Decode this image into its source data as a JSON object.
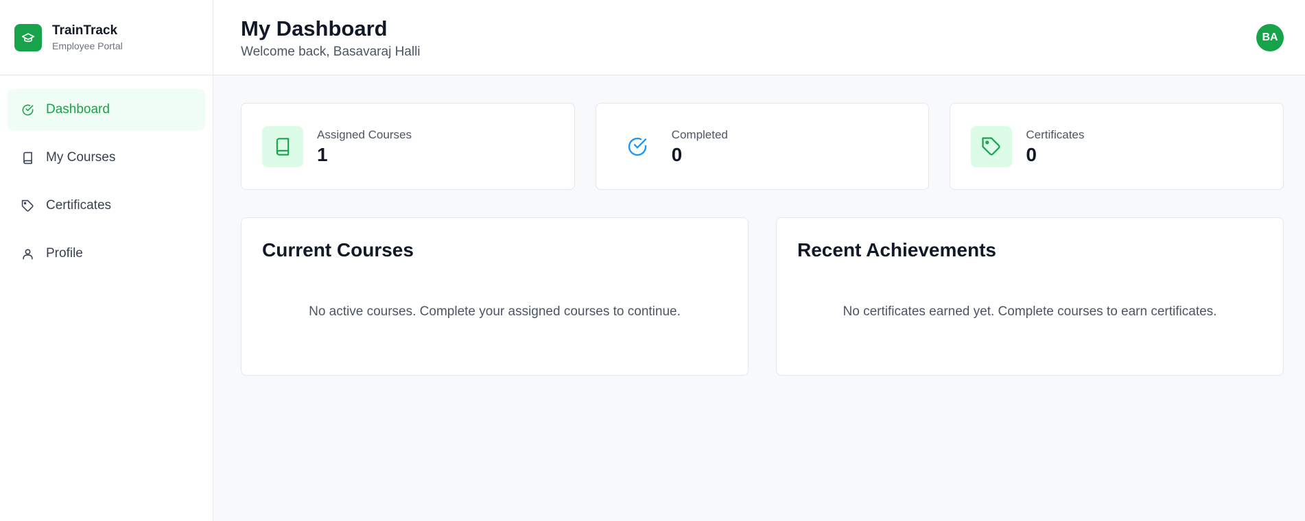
{
  "brand": {
    "name": "TrainTrack",
    "subtitle": "Employee Portal"
  },
  "sidebar": {
    "items": [
      {
        "label": "Dashboard",
        "icon": "check-circle-icon",
        "active": true
      },
      {
        "label": "My Courses",
        "icon": "book-icon",
        "active": false
      },
      {
        "label": "Certificates",
        "icon": "tag-icon",
        "active": false
      },
      {
        "label": "Profile",
        "icon": "user-icon",
        "active": false
      }
    ]
  },
  "header": {
    "title": "My Dashboard",
    "welcome": "Welcome back, Basavaraj Halli",
    "avatar_initials": "BA"
  },
  "stats": [
    {
      "label": "Assigned Courses",
      "value": "1",
      "icon": "book-icon"
    },
    {
      "label": "Completed",
      "value": "0",
      "icon": "check-circle-icon"
    },
    {
      "label": "Certificates",
      "value": "0",
      "icon": "tag-icon"
    }
  ],
  "panels": {
    "current_courses": {
      "title": "Current Courses",
      "empty_text": "No active courses. Complete your assigned courses to continue."
    },
    "recent_achievements": {
      "title": "Recent Achievements",
      "empty_text": "No certificates earned yet. Complete courses to earn certificates."
    }
  },
  "colors": {
    "accent": "#16a34a",
    "accent_light": "#dcfce7",
    "completed_icon": "#2196f3"
  }
}
